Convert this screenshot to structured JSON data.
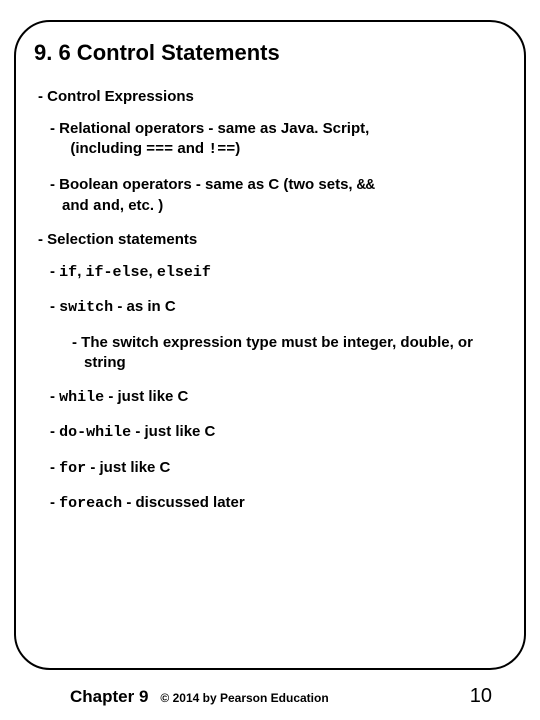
{
  "title": "9. 6 Control Statements",
  "lines": {
    "ctrlexp": "- Control Expressions",
    "relop_a": "- Relational operators - same as Java. Script,",
    "relop_b": "(including ",
    "relop_c1": "===",
    "relop_c2": " and ",
    "relop_c3": "!==",
    "relop_c4": ")",
    "bool_a": "- Boolean operators - same as C (two sets, ",
    "bool_b": "&&",
    "bool_c": " and ",
    "bool_d": "and",
    "bool_e": ", etc. )",
    "selstmt": "- Selection statements",
    "if_a": "- ",
    "if_b": "if",
    "if_c": ", ",
    "if_d": "if-else",
    "if_e": ", ",
    "if_f": "elseif",
    "switch_a": "- ",
    "switch_b": "switch",
    "switch_c": " - as in C",
    "switch_note": "- The switch expression type must be integer, double, or string",
    "while_a": "- ",
    "while_b": "while",
    "while_c": " - just like C",
    "do_a": "- ",
    "do_b": "do-while",
    "do_c": " - just like C",
    "for_a": "- ",
    "for_b": "for",
    "for_c": " - just like C",
    "foreach_a": "- ",
    "foreach_b": "foreach",
    "foreach_c": " - discussed later"
  },
  "footer": {
    "chapter": "Chapter 9",
    "copyright": "© 2014 by Pearson Education",
    "page": "10"
  }
}
